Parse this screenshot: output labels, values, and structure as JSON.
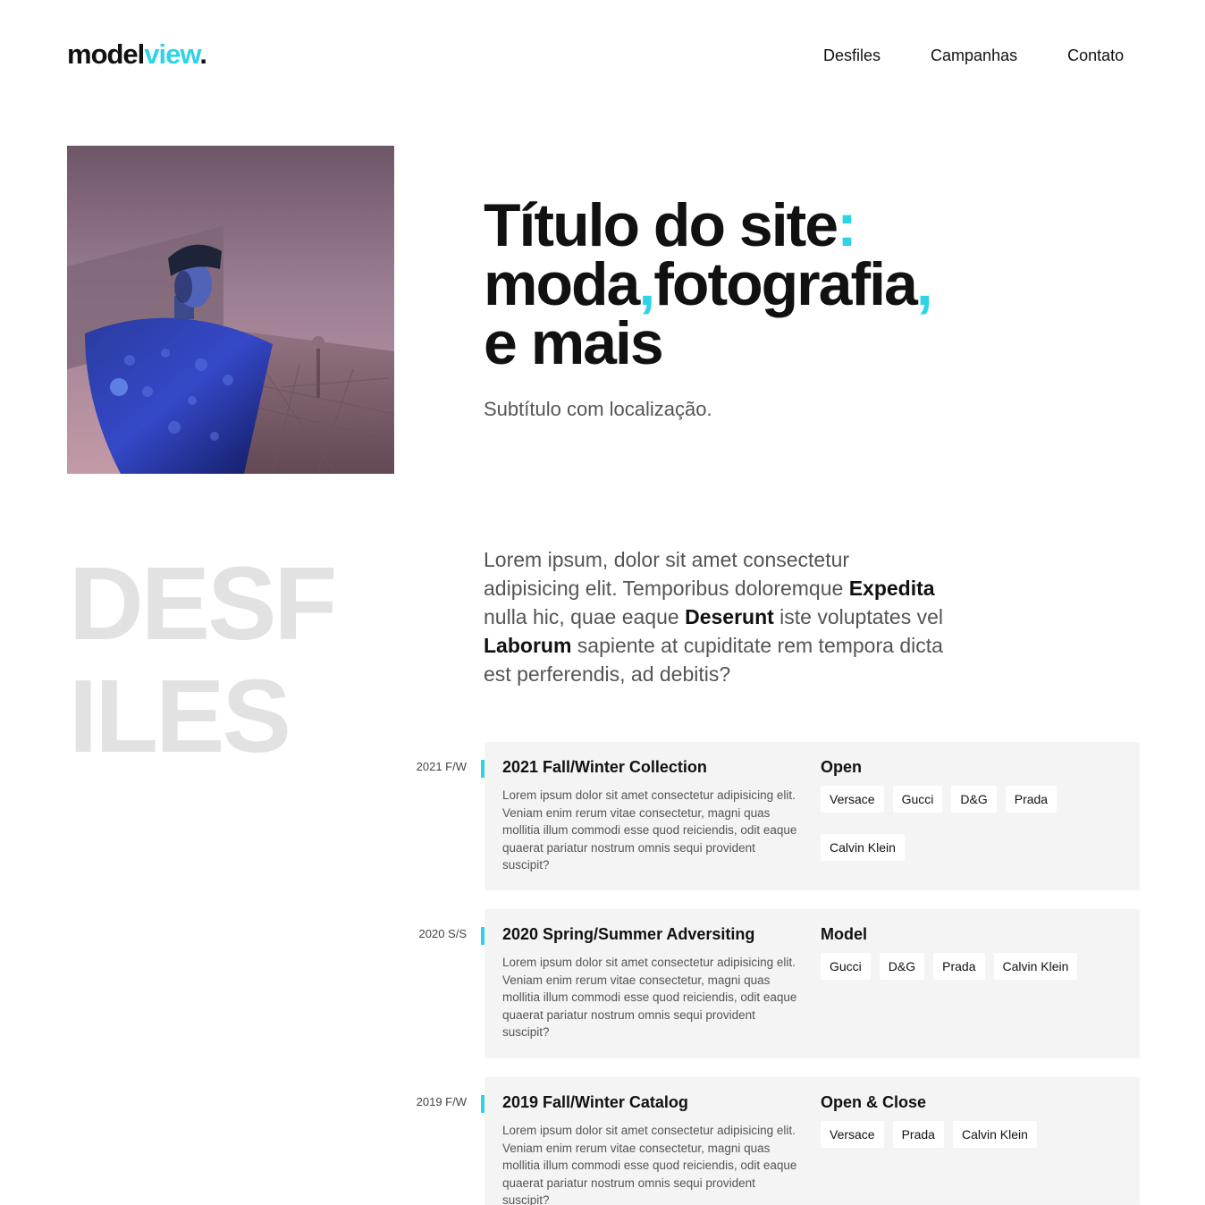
{
  "header": {
    "logo_main": "model",
    "logo_accent": "view",
    "logo_dot": ".",
    "nav": [
      "Desfiles",
      "Campanhas",
      "Contato"
    ]
  },
  "hero": {
    "title_line1": "Título do site",
    "title_colon": ":",
    "title_line2a": "moda",
    "title_comma1": ",",
    "title_line2b": "fotografia",
    "title_comma2": ",",
    "title_line3": "e mais",
    "subtitle": "Subtítulo com localização."
  },
  "section": {
    "big_title_1": "DESF",
    "big_title_2": "ILES",
    "intro_1": "Lorem ipsum, dolor sit amet consectetur adipisicing elit. Temporibus doloremque ",
    "intro_b1": "Expedita",
    "intro_2": " nulla hic, quae eaque ",
    "intro_b2": "Deserunt",
    "intro_3": " iste voluptates vel ",
    "intro_b3": "Laborum",
    "intro_4": " sapiente at cupiditate rem tempora dicta est perferendis, ad debitis?"
  },
  "items": [
    {
      "date": "2021 F/W",
      "title": "2021 Fall/Winter Collection",
      "desc": "Lorem ipsum dolor sit amet consectetur adipisicing elit. Veniam enim rerum vitae consectetur, magni quas mollitia illum commodi esse quod reiciendis, odit eaque quaerat pariatur nostrum omnis sequi provident suscipit?",
      "role": "Open",
      "tags": [
        "Versace",
        "Gucci",
        "D&G",
        "Prada",
        "Calvin Klein"
      ]
    },
    {
      "date": "2020 S/S",
      "title": "2020 Spring/Summer Adversiting",
      "desc": "Lorem ipsum dolor sit amet consectetur adipisicing elit. Veniam enim rerum vitae consectetur, magni quas mollitia illum commodi esse quod reiciendis, odit eaque quaerat pariatur nostrum omnis sequi provident suscipit?",
      "role": "Model",
      "tags": [
        "Gucci",
        "D&G",
        "Prada",
        "Calvin Klein"
      ]
    },
    {
      "date": "2019 F/W",
      "title": "2019 Fall/Winter Catalog",
      "desc": "Lorem ipsum dolor sit amet consectetur adipisicing elit. Veniam enim rerum vitae consectetur, magni quas mollitia illum commodi esse quod reiciendis, odit eaque quaerat pariatur nostrum omnis sequi provident suscipit?",
      "role": "Open & Close",
      "tags": [
        "Versace",
        "Prada",
        "Calvin Klein"
      ]
    }
  ],
  "colors": {
    "accent": "#2fd3e8",
    "card_bg": "#f4f4f4",
    "big_title": "#e2e2e2"
  }
}
